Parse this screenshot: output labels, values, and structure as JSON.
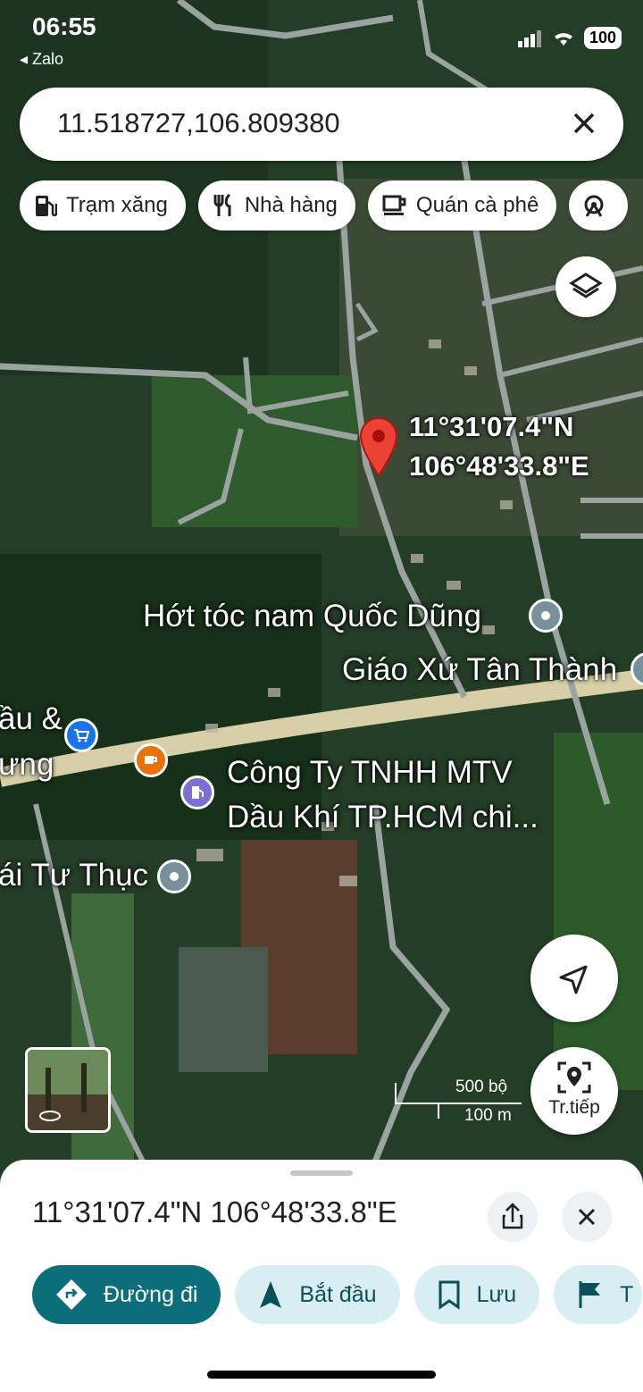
{
  "status_bar": {
    "time": "06:55",
    "back_app": "Zalo",
    "battery": "100"
  },
  "search": {
    "query": "11.518727,106.809380"
  },
  "chips": [
    {
      "label": "Trạm xăng",
      "icon": "gas-station-icon"
    },
    {
      "label": "Nhà hàng",
      "icon": "restaurant-icon"
    },
    {
      "label": "Quán cà phê",
      "icon": "coffee-icon"
    }
  ],
  "map": {
    "pin_label_line1": "11°31'07.4\"N",
    "pin_label_line2": "106°48'33.8\"E",
    "places": [
      {
        "name": "Hớt tóc nam Quốc Dũng"
      },
      {
        "name": "Giáo Xứ Tân Thành"
      },
      {
        "name": "Công Ty TNHH MTV"
      },
      {
        "name": "Dầu Khí TP.HCM chi..."
      },
      {
        "name": "ái Tư Thục"
      },
      {
        "name": "ầu &"
      },
      {
        "name": "ưng"
      }
    ],
    "scale_top": "500 bộ",
    "scale_bottom": "100 m",
    "recenter_label": "Tr.tiếp"
  },
  "sheet": {
    "title": "11°31'07.4\"N 106°48'33.8\"E",
    "actions": [
      {
        "label": "Đường đi"
      },
      {
        "label": "Bắt đầu"
      },
      {
        "label": "Lưu"
      },
      {
        "label": "T"
      }
    ]
  },
  "colors": {
    "primary": "#0b6e7a",
    "secondary": "#d9eef3",
    "pin": "#ea4335"
  }
}
